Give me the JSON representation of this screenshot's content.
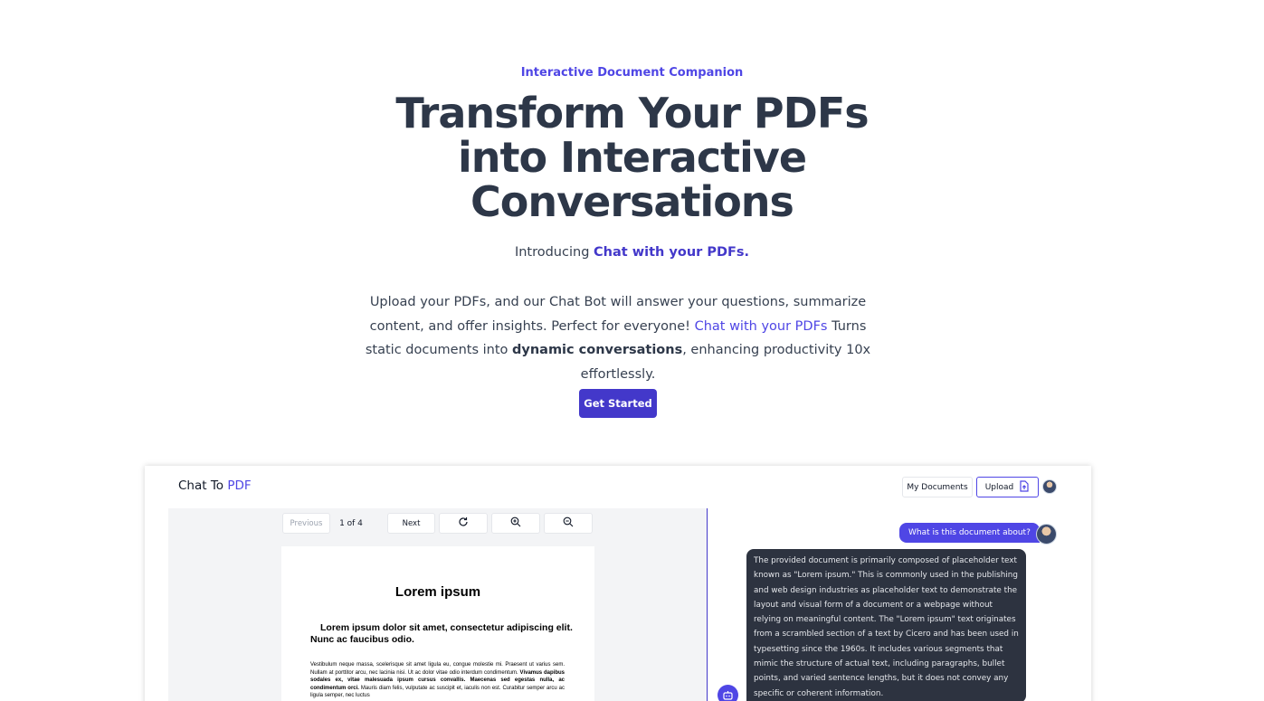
{
  "hero": {
    "eyebrow": "Interactive Document Companion",
    "headline_line1": "Transform Your PDFs",
    "headline_line2": "into Interactive",
    "headline_line3": "Conversations",
    "intro_prefix": "Introducing ",
    "intro_brand": "Chat with your PDFs.",
    "desc_part1": "Upload your PDFs, and our Chat Bot will answer your questions, summarize content, and offer insights. Perfect for everyone! ",
    "desc_link": "Chat with your PDFs",
    "desc_part2": " Turns static documents into ",
    "desc_bold": "dynamic conversations",
    "desc_part3": ", enhancing productivity 10x effortlessly.",
    "cta_label": "Get Started"
  },
  "app": {
    "logo_prefix": "Chat To ",
    "logo_accent": "PDF",
    "my_documents_label": "My Documents",
    "upload_label": "Upload",
    "toolbar": {
      "previous_label": "Previous",
      "page_indicator": "1 of 4",
      "next_label": "Next"
    },
    "pdf_page": {
      "title": "Lorem ipsum",
      "subtitle": "Lorem ipsum dolor sit amet, consectetur adipiscing elit. Nunc ac faucibus odio.",
      "body_part1": "Vestibulum neque massa, scelerisque sit amet ligula eu, congue molestie mi. Praesent ut varius sem. Nullam at porttitor arcu, nec lacinia nisi. Ut ac dolor vitae odio interdum condimentum. ",
      "body_bold": "Vivamus dapibus sodales ex, vitae malesuada ipsum cursus convallis. Maecenas sed egestas nulla, ac condimentum orci.",
      "body_part2": " Mauris diam felis, vulputate ac suscipit et, iaculis non est. Curabitur semper arcu ac ligula semper, nec luctus"
    },
    "chat": {
      "question": "What is this document about?",
      "answer": "The provided document is primarily composed of placeholder text known as \"Lorem ipsum.\" This is commonly used in the publishing and web design industries as placeholder text to demonstrate the layout and visual form of a document or a webpage without relying on meaningful content. The \"Lorem ipsum\" text originates from a scrambled section of a text by Cicero and has been used in typesetting since the 1960s. It includes various segments that mimic the structure of actual text, including paragraphs, bullet points, and varied sentence lengths, but it does not convey any specific or coherent information."
    },
    "icons": {
      "upload": "file-upload-icon",
      "rotate": "rotate-icon",
      "zoom_in": "zoom-in-icon",
      "zoom_out": "zoom-out-icon",
      "bot": "bot-icon"
    }
  },
  "colors": {
    "accent": "#4f46e5",
    "cta": "#4338ca",
    "heading": "#2d3748",
    "answer_bubble": "#2d3340"
  }
}
